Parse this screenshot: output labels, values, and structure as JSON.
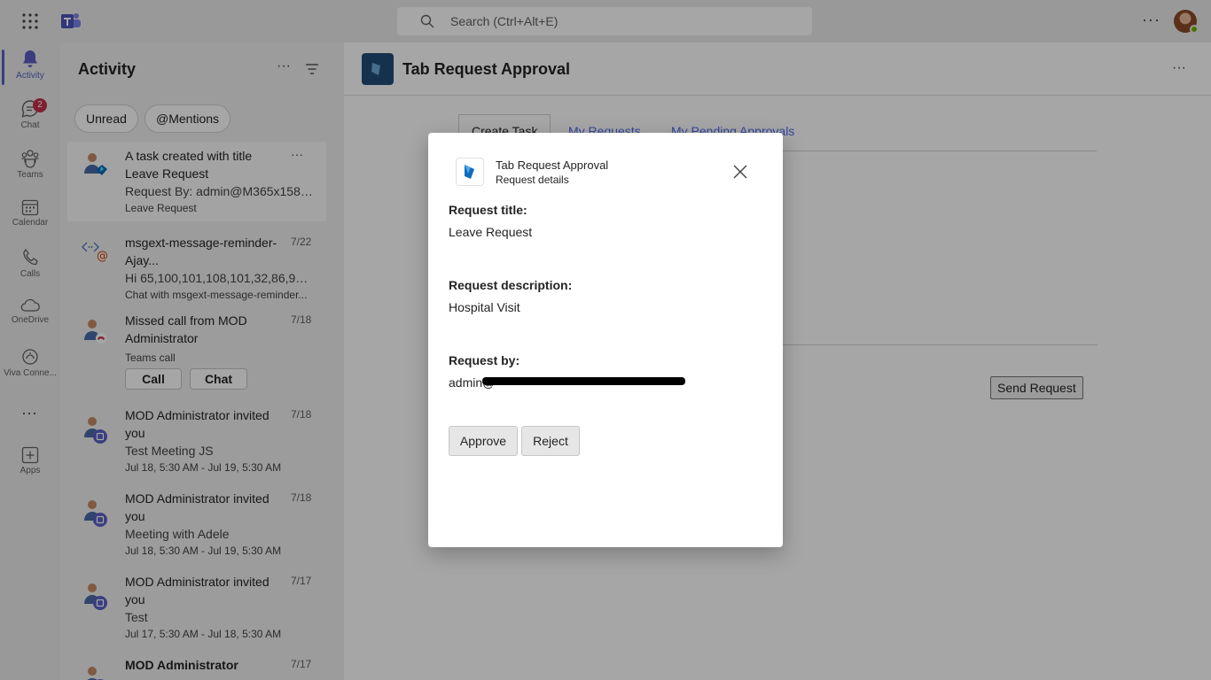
{
  "topbar": {
    "search_placeholder": "Search (Ctrl+Alt+E)",
    "more_label": "···"
  },
  "rail": {
    "items": [
      {
        "label": "Activity",
        "icon": "bell-icon",
        "active": true
      },
      {
        "label": "Chat",
        "icon": "chat-icon",
        "badge": "2"
      },
      {
        "label": "Teams",
        "icon": "teams-icon"
      },
      {
        "label": "Calendar",
        "icon": "calendar-icon"
      },
      {
        "label": "Calls",
        "icon": "phone-icon"
      },
      {
        "label": "OneDrive",
        "icon": "cloud-icon"
      },
      {
        "label": "Viva Conne...",
        "icon": "viva-icon"
      },
      {
        "label": "Apps",
        "icon": "plus-square-icon"
      }
    ],
    "more_label": "···"
  },
  "activity": {
    "title": "Activity",
    "more_label": "···",
    "filters": [
      "Unread",
      "@Mentions"
    ],
    "feed": [
      {
        "title": "A task created with title Leave Request",
        "line": "Request By: admin@M365x1585...",
        "sub": "Leave Request",
        "date": "",
        "more": "···"
      },
      {
        "title": "msgext-message-reminder-Ajay...",
        "line": "Hi 65,100,101,108,101,32,86,97,1...",
        "sub": "Chat with msgext-message-reminder...",
        "date": "7/22"
      },
      {
        "title": "Missed call from MOD Administrator",
        "sub": "Teams call",
        "date": "7/18",
        "buttons": [
          "Call",
          "Chat"
        ]
      },
      {
        "title": "MOD Administrator invited you",
        "line": "Test Meeting JS",
        "sub": "Jul 18, 5:30 AM - Jul 19, 5:30 AM",
        "date": "7/18"
      },
      {
        "title": "MOD Administrator invited you",
        "line": "Meeting with Adele",
        "sub": "Jul 18, 5:30 AM - Jul 19, 5:30 AM",
        "date": "7/18"
      },
      {
        "title": "MOD Administrator invited you",
        "line": "Test",
        "sub": "Jul 17, 5:30 AM - Jul 18, 5:30 AM",
        "date": "7/17"
      },
      {
        "title": "MOD Administrator",
        "date": "7/17"
      }
    ]
  },
  "main": {
    "app_title": "Tab Request Approval",
    "more_label": "···",
    "tabs": [
      "Create Task",
      "My Requests",
      "My Pending Approvals"
    ],
    "send_request_label": "Send Request"
  },
  "dialog": {
    "app_name": "Tab Request Approval",
    "subtitle": "Request details",
    "fields": [
      {
        "label": "Request title:",
        "value": "Leave Request"
      },
      {
        "label": "Request description:",
        "value": "Hospital Visit"
      },
      {
        "label": "Request by:",
        "value": "admin@"
      }
    ],
    "approve_label": "Approve",
    "reject_label": "Reject"
  },
  "colors": {
    "accent": "#5b5fc7",
    "badge": "#c4314b",
    "link": "#4f6bed",
    "app_icon": "#1f4e79"
  }
}
